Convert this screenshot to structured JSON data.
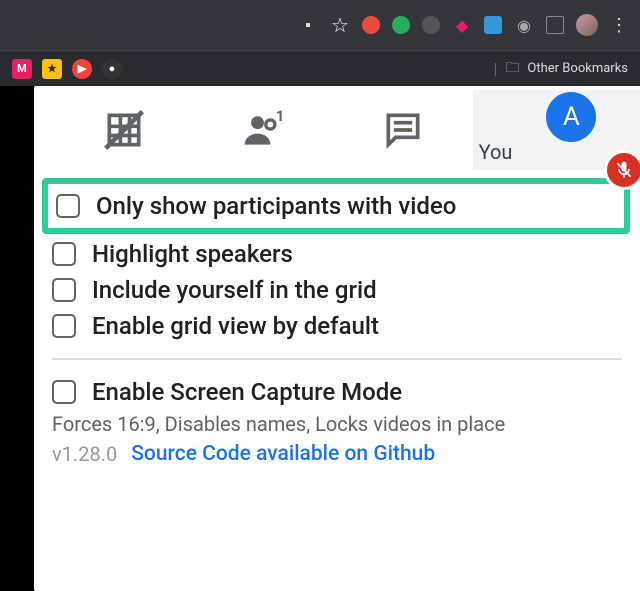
{
  "browser": {
    "other_bookmarks": "Other Bookmarks"
  },
  "meet": {
    "you_label": "You",
    "avatar_letter": "A"
  },
  "options": {
    "only_video": "Only show participants with video",
    "highlight_speakers": "Highlight speakers",
    "include_self": "Include yourself in the grid",
    "enable_default": "Enable grid view by default",
    "screen_capture": "Enable Screen Capture Mode",
    "screen_capture_desc": "Forces 16:9, Disables names, Locks videos in place"
  },
  "footer": {
    "version": "v1.28.0",
    "link": "Source Code available on Github"
  }
}
